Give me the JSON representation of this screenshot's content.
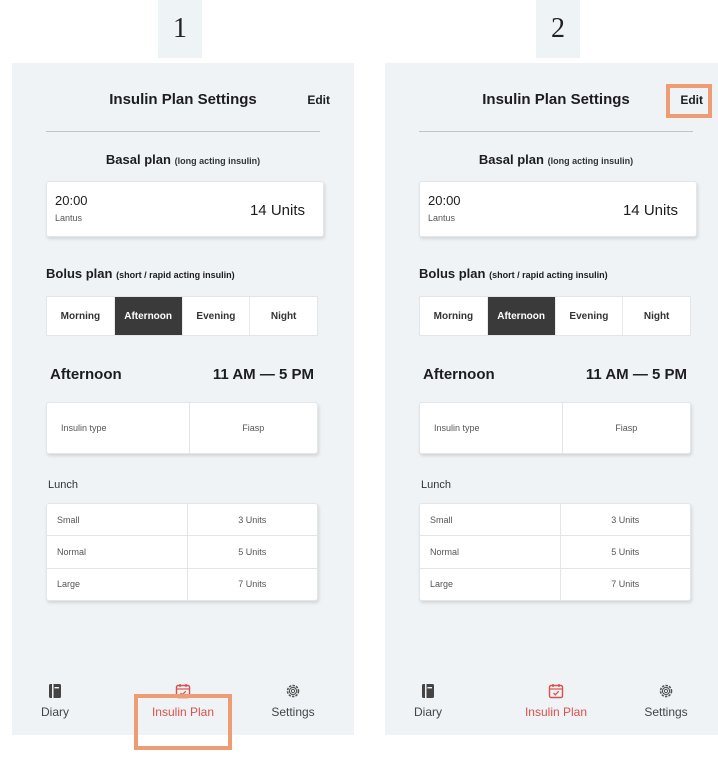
{
  "labels": {
    "panel1": "1",
    "panel2": "2"
  },
  "screen": {
    "title": "Insulin Plan Settings",
    "edit_label": "Edit",
    "basal": {
      "title": "Basal plan",
      "subtitle": "(long acting insulin)",
      "time": "20:00",
      "drug": "Lantus",
      "units": "14 Units"
    },
    "bolus": {
      "title": "Bolus plan",
      "subtitle": "(short / rapid acting insulin)",
      "tabs": [
        "Morning",
        "Afternoon",
        "Evening",
        "Night"
      ],
      "active_tab": "Afternoon"
    },
    "period": {
      "name": "Afternoon",
      "time": "11 AM — 5 PM"
    },
    "insulin_type": {
      "label": "Insulin type",
      "value": "Fiasp"
    },
    "meal": {
      "title": "Lunch",
      "rows": [
        {
          "size": "Small",
          "units": "3 Units"
        },
        {
          "size": "Normal",
          "units": "5 Units"
        },
        {
          "size": "Large",
          "units": "7 Units"
        }
      ]
    },
    "nav": [
      {
        "label": "Diary",
        "icon": "book-icon"
      },
      {
        "label": "Insulin Plan",
        "icon": "calendar-check-icon"
      },
      {
        "label": "Settings",
        "icon": "gear-icon"
      }
    ],
    "active_nav": "Insulin Plan"
  },
  "colors": {
    "highlight": "#ed9c73",
    "active_nav": "#d9514b",
    "active_tab_bg": "#3a3a3a"
  }
}
